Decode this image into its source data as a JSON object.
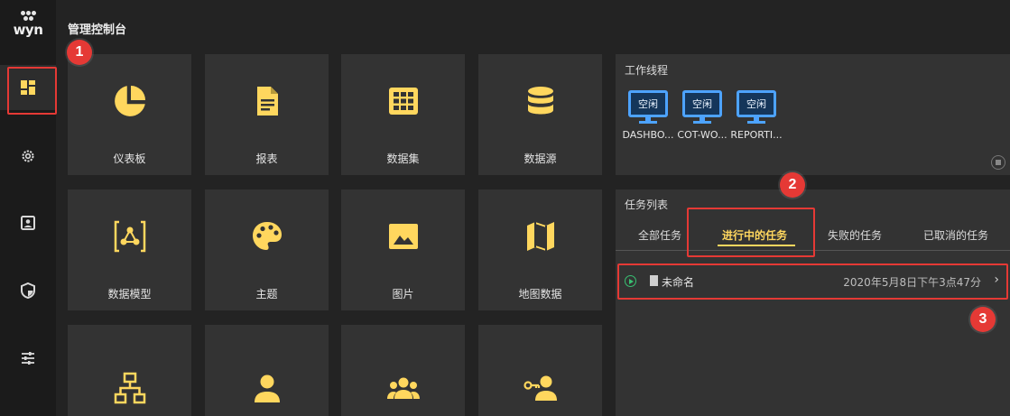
{
  "app": {
    "logo_text": "wyn",
    "page_title": "管理控制台"
  },
  "sidebar": {
    "items": [
      {
        "name": "dashboard-icon",
        "active": true
      },
      {
        "name": "gear-icon",
        "active": false
      },
      {
        "name": "user-card-icon",
        "active": false
      },
      {
        "name": "shield-icon",
        "active": false
      },
      {
        "name": "sliders-icon",
        "active": false
      }
    ]
  },
  "tiles": [
    {
      "label": "仪表板",
      "icon": "pie-chart-icon"
    },
    {
      "label": "报表",
      "icon": "document-icon"
    },
    {
      "label": "数据集",
      "icon": "table-grid-icon"
    },
    {
      "label": "数据源",
      "icon": "database-icon"
    },
    {
      "label": "数据模型",
      "icon": "data-model-icon"
    },
    {
      "label": "主题",
      "icon": "palette-icon"
    },
    {
      "label": "图片",
      "icon": "image-icon"
    },
    {
      "label": "地图数据",
      "icon": "map-icon"
    },
    {
      "label": "",
      "icon": "org-tree-icon"
    },
    {
      "label": "",
      "icon": "user-icon"
    },
    {
      "label": "",
      "icon": "group-icon"
    },
    {
      "label": "",
      "icon": "user-key-icon"
    }
  ],
  "worker_panel": {
    "title": "工作线程",
    "workers": [
      {
        "status": "空闲",
        "name": "DASHBO..."
      },
      {
        "status": "空闲",
        "name": "COT-WO..."
      },
      {
        "status": "空闲",
        "name": "REPORTI..."
      }
    ]
  },
  "task_panel": {
    "title": "任务列表",
    "tabs": [
      "全部任务",
      "进行中的任务",
      "失败的任务",
      "已取消的任务"
    ],
    "active_tab": "进行中的任务",
    "tasks": [
      {
        "name": "未命名",
        "time": "2020年5月8日下午3点47分"
      }
    ]
  },
  "annotations": [
    "1",
    "2",
    "3"
  ],
  "colors": {
    "accent": "#ffd75e",
    "worker": "#4da3ff",
    "annotation": "#e53935",
    "running": "#38c172"
  }
}
